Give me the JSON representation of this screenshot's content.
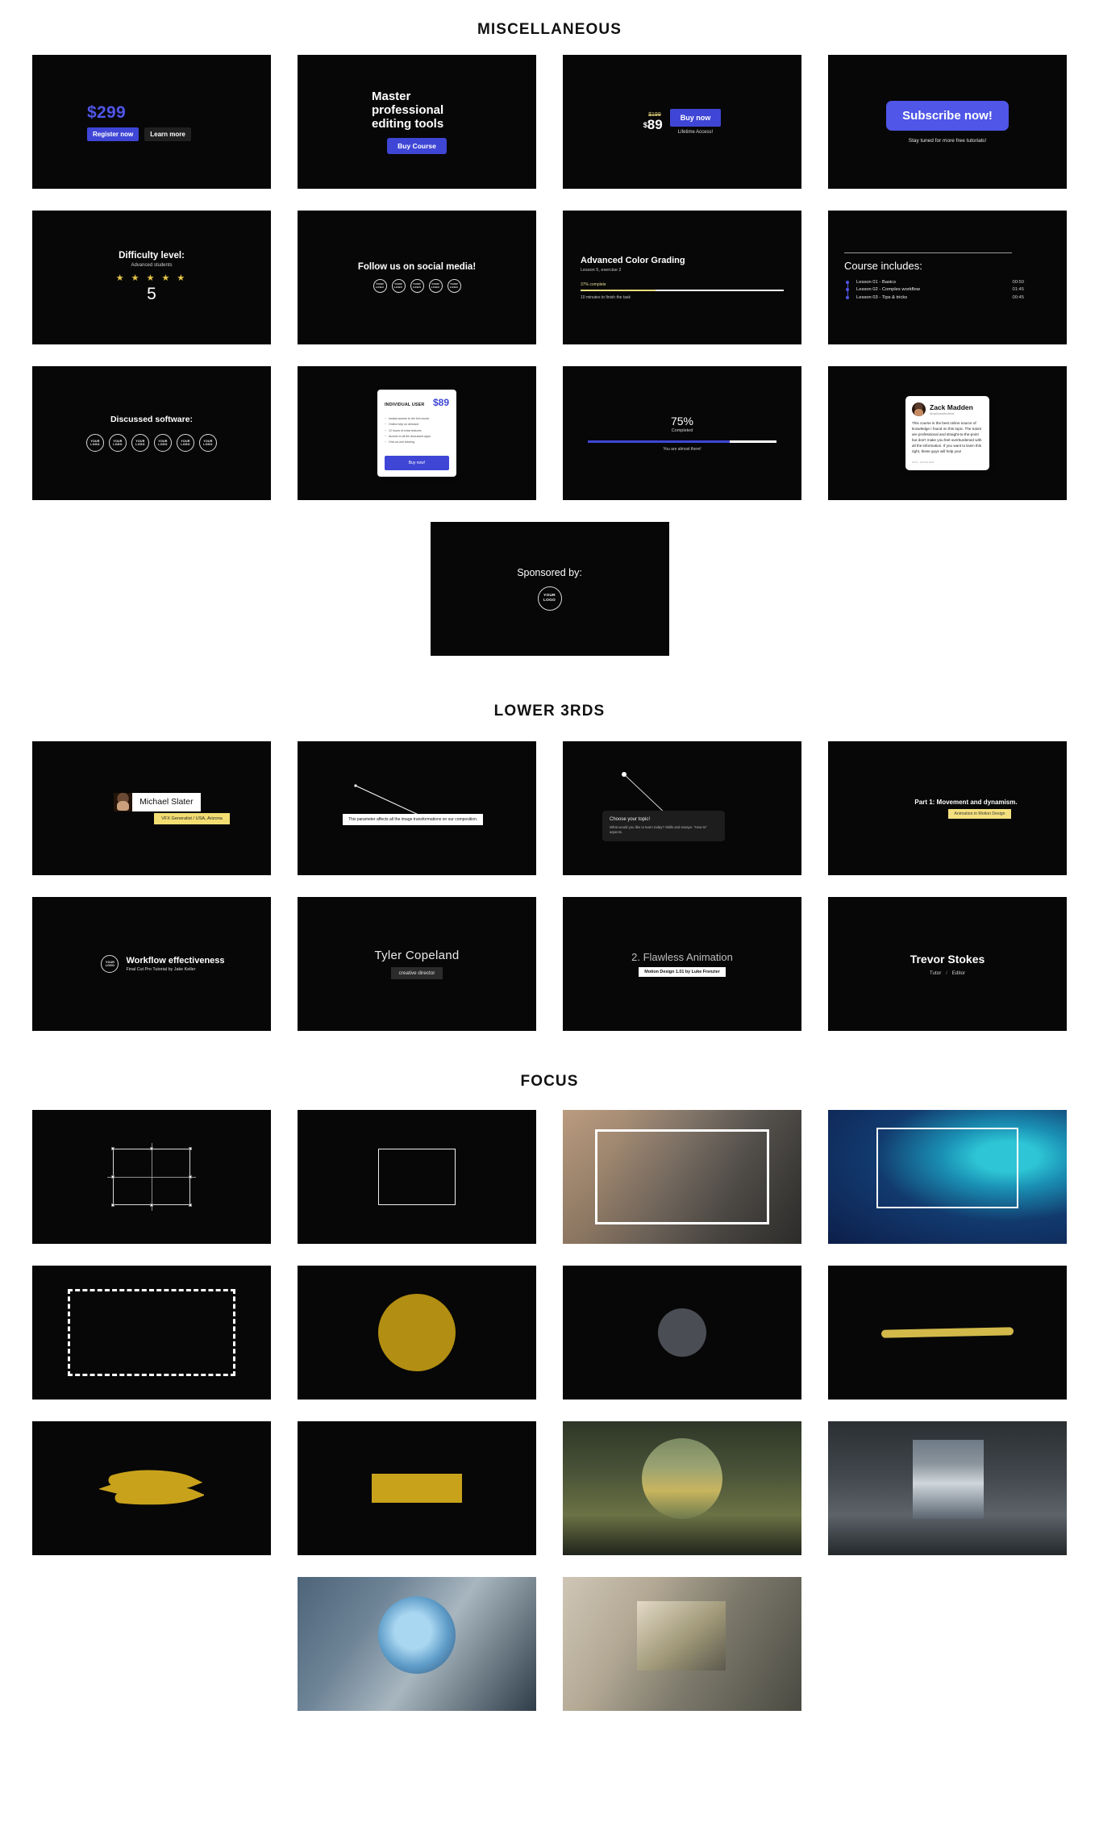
{
  "sections": {
    "misc_title": "MISCELLANEOUS",
    "lower_title": "LOWER 3RDS",
    "focus_title": "FOCUS"
  },
  "colors": {
    "blue": "#3f46d6",
    "blue_bright": "#4f56e8",
    "yellow": "#e8c84a",
    "tag_yellow": "#f2de72",
    "gold": "#c9a21c"
  },
  "misc": {
    "price_register": {
      "amount": "$299",
      "primary_button": "Register now",
      "secondary_button": "Learn more"
    },
    "master_tools": {
      "headline": "Master professional editing tools",
      "button": "Buy Course"
    },
    "buy_now": {
      "old_price": "$199",
      "currency": "$",
      "price": "89",
      "button": "Buy now",
      "note": "Lifetime Access!"
    },
    "subscribe": {
      "button": "Subscribe now!",
      "note": "Stay tuned for more free tutorials!"
    },
    "difficulty": {
      "title": "Difficulty level:",
      "subtitle": "Advanced students",
      "stars": "★ ★ ★ ★ ★",
      "value": "5"
    },
    "social": {
      "title": "Follow us on social media!",
      "logo_line1": "YOUR",
      "logo_line2": "LOGO",
      "logo_count": 5
    },
    "color_grading": {
      "title": "Advanced Color Grading",
      "subtitle": "Lesson 5, exercise 2",
      "percent_label": "37% complete",
      "percent_value": 37,
      "time_left": "10 minutes to finish the task"
    },
    "course_includes": {
      "title": "Course includes:",
      "lessons": [
        {
          "name": "Lesson 01 - Basics",
          "time": "00:50"
        },
        {
          "name": "Lesson 02 - Complex workflow",
          "time": "01:45"
        },
        {
          "name": "Lesson 03 - Tips & tricks",
          "time": "00:45"
        }
      ]
    },
    "discussed_software": {
      "title": "Discussed software:",
      "logo_line1": "YOUR",
      "logo_line2": "LOGO",
      "logo_count": 6
    },
    "pricing_card": {
      "label": "INDIVIDUAL USER",
      "amount": "$89",
      "features": [
        "Instant access to the full course",
        "Online help on demand",
        "12 hours of extra lectures",
        "Access to all the discussed apps",
        "One-on-one tutoring"
      ],
      "button": "Buy now!"
    },
    "progress": {
      "percent": "75%",
      "percent_value": 75,
      "label": "Completed",
      "hint": "You are almost there!"
    },
    "testimonial": {
      "name": "Zack Madden",
      "handle": "@zackmaddenofficial",
      "body": "This course is the best online source of knowledge I found on this topic. The tutors are professional and straight-to-the-point but don't make you feel overburdened with all the information. If you want to learn this right, these guys will help you!",
      "timestamp": "18:31 - JUN 09, 2021"
    },
    "sponsored": {
      "title": "Sponsored by:",
      "logo_line1": "YOUR",
      "logo_line2": "LOGO"
    }
  },
  "lower_thirds": {
    "michael": {
      "name": "Michael Slater",
      "role": "VFX Generalist / USA, Arizona"
    },
    "callout": {
      "text": "This parameter affects all the image transformations on our composition."
    },
    "topic": {
      "title": "Choose your topic!",
      "subtitle": "What would you like to learn today? Skills and essays. \"How to\" aspects."
    },
    "part": {
      "title": "Part 1: Movement and dynamism.",
      "tag": "Animation in Motion Design"
    },
    "workflow": {
      "logo_line1": "YOUR",
      "logo_line2": "LOGO",
      "title": "Workflow effectiveness",
      "subtitle": "Final Cut Pro Tutorial by Jake Keller"
    },
    "tyler": {
      "name": "Tyler Copeland",
      "role": "creative director"
    },
    "flawless": {
      "title": "2. Flawless Animation",
      "tag": "Motion Design 1.01 by Luke Frenzier"
    },
    "trevor": {
      "name": "Trevor Stokes",
      "role_left": "Tutor",
      "role_sep": "/",
      "role_right": "Editor"
    }
  },
  "focus": {
    "items": [
      {
        "name": "transform-handles",
        "kind": "shape"
      },
      {
        "name": "rectangle-outline",
        "kind": "shape"
      },
      {
        "name": "photo-desk-framed",
        "kind": "photo"
      },
      {
        "name": "photo-coast-framed",
        "kind": "photo"
      },
      {
        "name": "dashed-rectangle",
        "kind": "shape"
      },
      {
        "name": "yellow-circle",
        "kind": "shape"
      },
      {
        "name": "grey-circle",
        "kind": "shape"
      },
      {
        "name": "yellow-brush-stroke",
        "kind": "shape"
      },
      {
        "name": "yellow-scribble",
        "kind": "shape"
      },
      {
        "name": "yellow-rectangle",
        "kind": "shape"
      },
      {
        "name": "photo-field-circle-mask",
        "kind": "photo"
      },
      {
        "name": "photo-mountain-square-mask",
        "kind": "photo"
      },
      {
        "name": "photo-office-monitor",
        "kind": "photo"
      },
      {
        "name": "photo-workshop-tools",
        "kind": "photo"
      }
    ]
  }
}
